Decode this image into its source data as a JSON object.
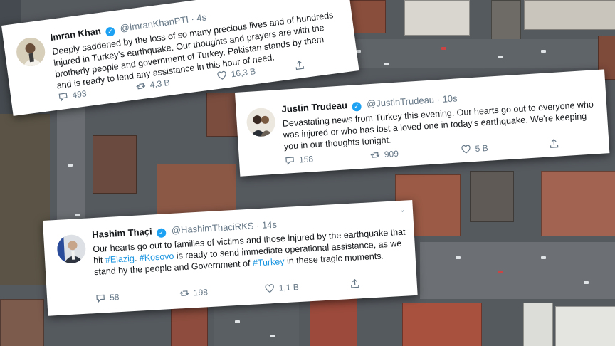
{
  "tweets": [
    {
      "name": "Imran Khan",
      "handle": "@ImranKhanPTI",
      "time": "· 4s",
      "text": "Deeply saddened by the loss of so many precious lives and of hundreds injured in Turkey's earthquake. Our thoughts and prayers are with the brotherly people and government of Turkey. Pakistan stands by them and is ready to lend any assistance in this hour of need.",
      "replies": "493",
      "retweets": "4,3 B",
      "likes": "16,3 B"
    },
    {
      "name": "Justin Trudeau",
      "handle": "@JustinTrudeau",
      "time": "· 10s",
      "text": "Devastating news from Turkey this evening. Our hearts go out to everyone who was injured or who has lost a loved one in today's earthquake. We're keeping you in our thoughts tonight.",
      "replies": "158",
      "retweets": "909",
      "likes": "5 B"
    },
    {
      "name": "Hashim Thaçi",
      "handle": "@HashimThaciRKS",
      "time": "· 14s",
      "text_parts": {
        "a": "Our hearts go out to families of victims and those injured by the earthquake that hit ",
        "h1": "#Elazig",
        "b": ". ",
        "h2": "#Kosovo",
        "c": " is ready to send immediate operational assistance, as we stand by the people and Government of ",
        "h3": "#Turkey",
        "d": " in these tragic moments."
      },
      "replies": "58",
      "retweets": "198",
      "likes": "1,1 B"
    }
  ],
  "icons": {
    "reply": "reply-icon",
    "retweet": "retweet-icon",
    "like": "heart-icon",
    "share": "share-icon",
    "verified": "verified-badge-icon",
    "menu": "chevron-down-icon"
  },
  "colors": {
    "link": "#1b95e0",
    "verified": "#1da1f2",
    "muted": "#657786"
  }
}
